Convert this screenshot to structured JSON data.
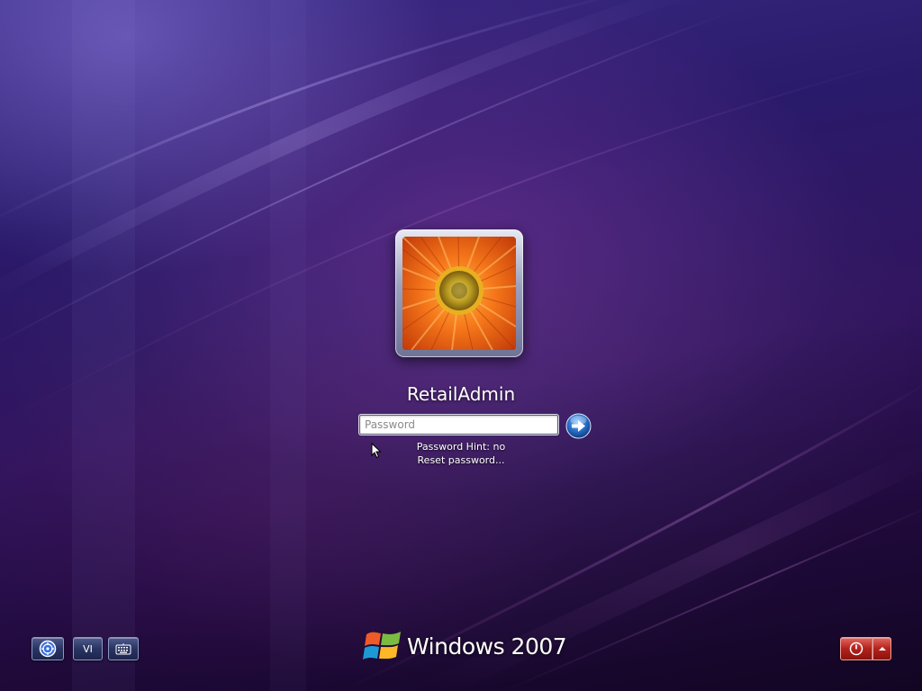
{
  "user": {
    "name": "RetailAdmin",
    "avatar_icon": "orange-flower-icon"
  },
  "login": {
    "password_placeholder": "Password",
    "password_value": "",
    "submit_icon": "arrow-right-icon",
    "hint_text": "Password Hint: no",
    "reset_link": "Reset password..."
  },
  "utility_buttons": {
    "ease_of_access_icon": "ease-of-access-icon",
    "language_label": "VI",
    "keyboard_icon": "keyboard-icon"
  },
  "branding": {
    "logo_icon": "windows-flag-icon",
    "text": "Windows 2007"
  },
  "power": {
    "shutdown_icon": "power-icon",
    "options_icon": "chevron-up-icon"
  },
  "colors": {
    "background_dark": "#200a3c",
    "background_light": "#3a2c86",
    "submit_blue": "#2a72c8",
    "power_red": "#b3221b",
    "avatar_orange": "#f07a1c"
  }
}
